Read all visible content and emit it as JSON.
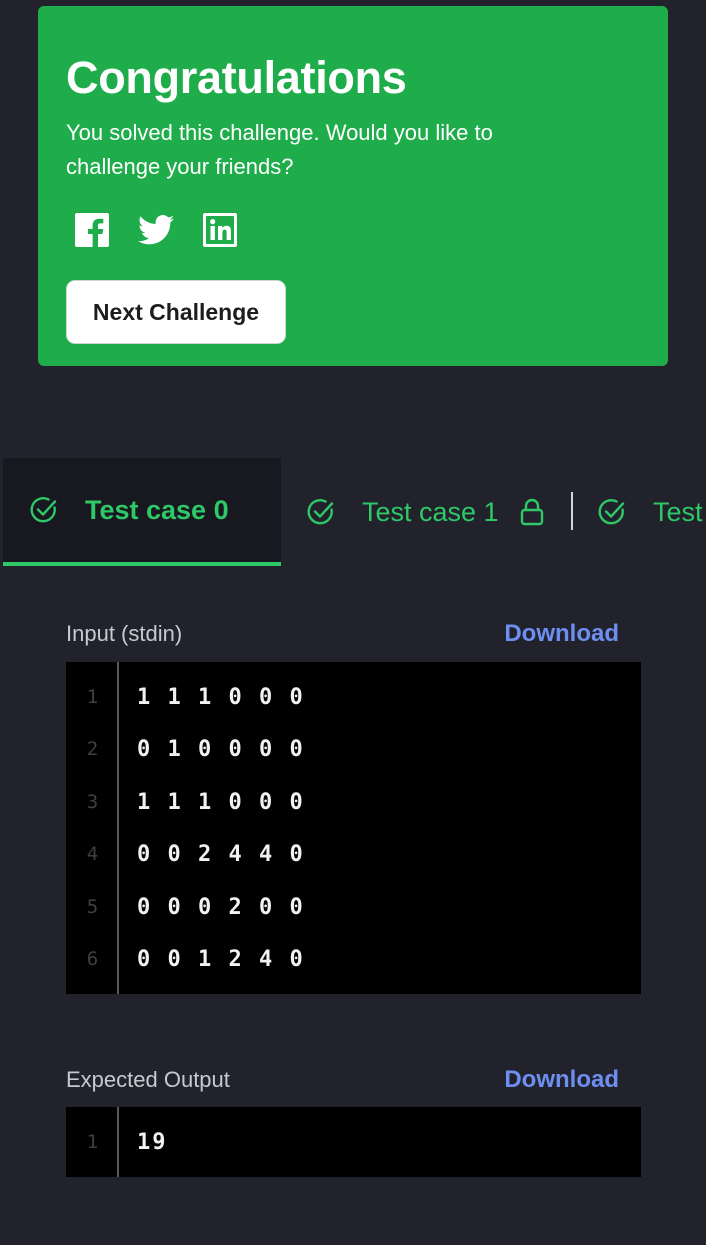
{
  "banner": {
    "title": "Congratulations",
    "message": "You solved this challenge. Would you like to challenge your friends?",
    "social": [
      {
        "name": "facebook-icon"
      },
      {
        "name": "twitter-icon"
      },
      {
        "name": "linkedin-icon"
      }
    ],
    "next_button_label": "Next Challenge",
    "background_color": "#1fac4b"
  },
  "tabs": [
    {
      "label": "Test case 0",
      "active": true,
      "passed": true
    },
    {
      "label": "Test case 1",
      "active": false,
      "passed": true,
      "locked": true
    },
    {
      "label": "Test",
      "active": false,
      "passed": true
    }
  ],
  "input": {
    "label": "Input (stdin)",
    "download_label": "Download",
    "lines": [
      {
        "num": "1",
        "text": "1 1 1 0 0 0"
      },
      {
        "num": "2",
        "text": "0 1 0 0 0 0"
      },
      {
        "num": "3",
        "text": "1 1 1 0 0 0"
      },
      {
        "num": "4",
        "text": "0 0 2 4 4 0"
      },
      {
        "num": "5",
        "text": "0 0 0 2 0 0"
      },
      {
        "num": "6",
        "text": "0 0 1 2 4 0"
      }
    ]
  },
  "expected_output": {
    "label": "Expected Output",
    "download_label": "Download",
    "lines": [
      {
        "num": "1",
        "text": "19"
      }
    ]
  },
  "colors": {
    "accent_green": "#2ec866",
    "link_blue": "#6c8ff0",
    "page_background": "#22222d"
  }
}
